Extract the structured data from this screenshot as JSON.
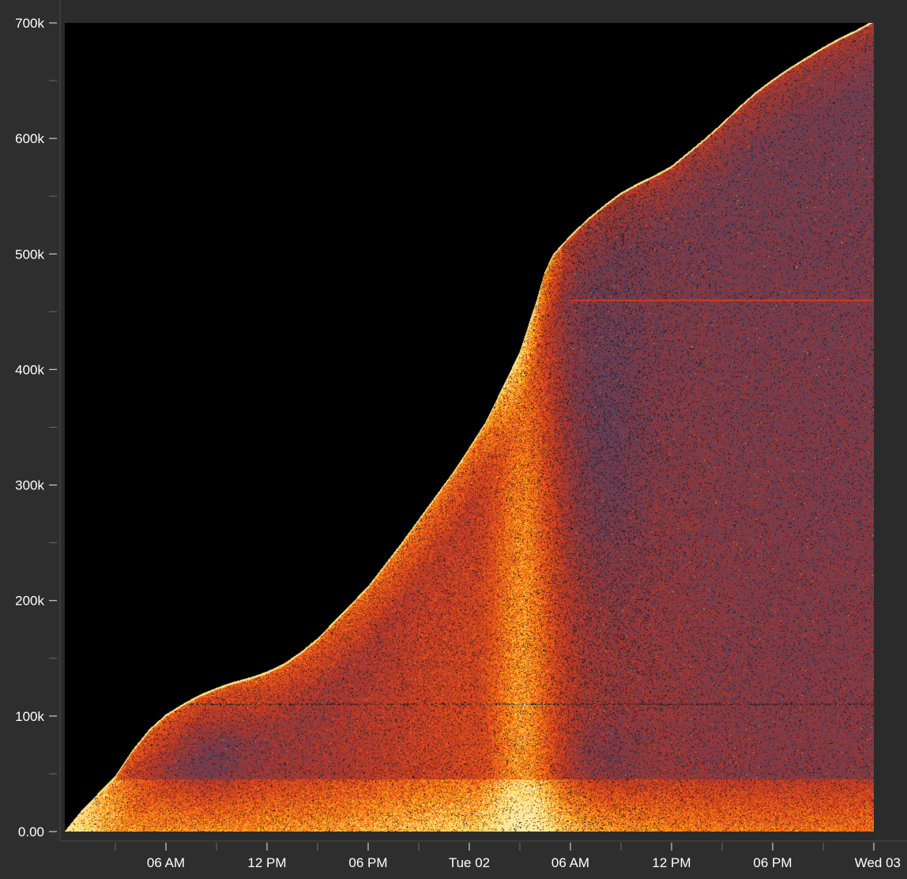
{
  "chart_data": {
    "type": "heatmap",
    "title": "",
    "xlabel": "",
    "ylabel": "",
    "ylim": [
      0,
      700000
    ],
    "xlim": [
      "00:00 (Mon 01)",
      "00:00 (Wed 03)"
    ],
    "x_ticks": [
      {
        "t": 6,
        "label": "06 AM"
      },
      {
        "t": 12,
        "label": "12 PM"
      },
      {
        "t": 18,
        "label": "06 PM"
      },
      {
        "t": 24,
        "label": "Tue 02"
      },
      {
        "t": 30,
        "label": "06 AM"
      },
      {
        "t": 36,
        "label": "12 PM"
      },
      {
        "t": 42,
        "label": "06 PM"
      },
      {
        "t": 48,
        "label": "Wed 03"
      }
    ],
    "y_ticks": [
      {
        "v": 0,
        "label": "0.00"
      },
      {
        "v": 100000,
        "label": "100k"
      },
      {
        "v": 200000,
        "label": "200k"
      },
      {
        "v": 300000,
        "label": "300k"
      },
      {
        "v": 400000,
        "label": "400k"
      },
      {
        "v": 500000,
        "label": "500k"
      },
      {
        "v": 600000,
        "label": "600k"
      },
      {
        "v": 700000,
        "label": "700k"
      }
    ],
    "boundary": [
      [
        0,
        0
      ],
      [
        1,
        18000
      ],
      [
        2,
        33000
      ],
      [
        3,
        48000
      ],
      [
        4,
        70000
      ],
      [
        5,
        88000
      ],
      [
        6,
        101000
      ],
      [
        7,
        110000
      ],
      [
        8,
        118000
      ],
      [
        9,
        124000
      ],
      [
        10,
        129000
      ],
      [
        11,
        133000
      ],
      [
        12,
        138000
      ],
      [
        13,
        145000
      ],
      [
        14,
        155000
      ],
      [
        15,
        167000
      ],
      [
        16,
        182000
      ],
      [
        17,
        197000
      ],
      [
        18,
        212000
      ],
      [
        19,
        231000
      ],
      [
        20,
        250000
      ],
      [
        21,
        270000
      ],
      [
        22,
        290000
      ],
      [
        23,
        310000
      ],
      [
        24,
        332000
      ],
      [
        25,
        355000
      ],
      [
        26,
        385000
      ],
      [
        27,
        415000
      ],
      [
        28,
        460000
      ],
      [
        28.5,
        485000
      ],
      [
        29,
        500000
      ],
      [
        30,
        516000
      ],
      [
        31,
        530000
      ],
      [
        32,
        542000
      ],
      [
        33,
        553000
      ],
      [
        34,
        561000
      ],
      [
        35,
        568000
      ],
      [
        36,
        576000
      ],
      [
        37,
        588000
      ],
      [
        38,
        600000
      ],
      [
        39,
        613000
      ],
      [
        40,
        627000
      ],
      [
        41,
        640000
      ],
      [
        42,
        651000
      ],
      [
        43,
        661000
      ],
      [
        44,
        670000
      ],
      [
        45,
        679000
      ],
      [
        46,
        687000
      ],
      [
        47,
        694000
      ],
      [
        48,
        702000
      ]
    ],
    "colors": {
      "background": "#000000",
      "cold": "#4a4568",
      "warm": "#e0401a",
      "hot": "#ffc020",
      "edge": "#ffe9a0"
    }
  }
}
